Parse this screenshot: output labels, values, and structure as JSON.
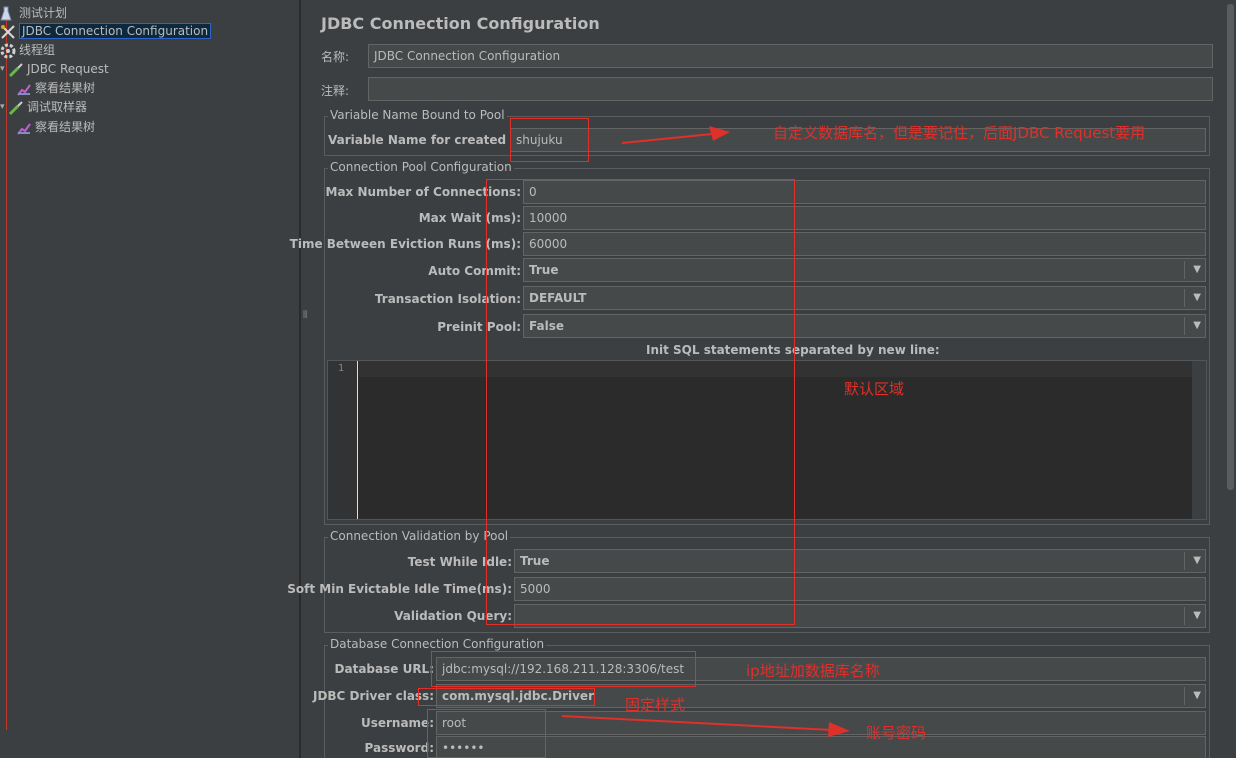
{
  "tree": {
    "items": [
      {
        "label": "测试计划"
      },
      {
        "label": "JDBC Connection Configuration"
      },
      {
        "label": "线程组"
      },
      {
        "label": "JDBC Request"
      },
      {
        "label": "察看结果树"
      },
      {
        "label": "调试取样器"
      },
      {
        "label": "察看结果树"
      }
    ]
  },
  "panel": {
    "title": "JDBC Connection Configuration",
    "name_label": "名称:",
    "name_value": "JDBC Connection Configuration",
    "comment_label": "注释:",
    "comment_value": ""
  },
  "pool_binding": {
    "group_title": "Variable Name Bound to Pool",
    "var_label": "Variable Name for created pool:",
    "var_value": "shujuku"
  },
  "pool_config": {
    "group_title": "Connection Pool Configuration",
    "max_conn_label": "Max Number of Connections:",
    "max_conn_value": "0",
    "max_wait_label": "Max Wait (ms):",
    "max_wait_value": "10000",
    "eviction_label": "Time Between Eviction Runs (ms):",
    "eviction_value": "60000",
    "auto_commit_label": "Auto Commit:",
    "auto_commit_value": "True",
    "isolation_label": "Transaction Isolation:",
    "isolation_value": "DEFAULT",
    "preinit_label": "Preinit Pool:",
    "preinit_value": "False",
    "init_sql_label": "Init SQL statements separated by new line:",
    "line_number": "1"
  },
  "validation": {
    "group_title": "Connection Validation by Pool",
    "test_idle_label": "Test While Idle:",
    "test_idle_value": "True",
    "soft_min_label": "Soft Min Evictable Idle Time(ms):",
    "soft_min_value": "5000",
    "query_label": "Validation Query:",
    "query_value": ""
  },
  "db_config": {
    "group_title": "Database Connection Configuration",
    "url_label": "Database URL:",
    "url_value": "jdbc:mysql://192.168.211.128:3306/test",
    "driver_label": "JDBC Driver class:",
    "driver_value": "com.mysql.jdbc.Driver",
    "user_label": "Username:",
    "user_value": "root",
    "pass_label": "Password:",
    "pass_value": "••••••"
  },
  "annotations": {
    "pool_name_note": "自定义数据库名，但是要记住，后面JDBC Request要用",
    "default_area_note": "默认区域",
    "ip_note": "ip地址加数据库名称",
    "fixed_note": "固定样式",
    "account_note": "账号密码",
    "color": "#e0302a"
  }
}
